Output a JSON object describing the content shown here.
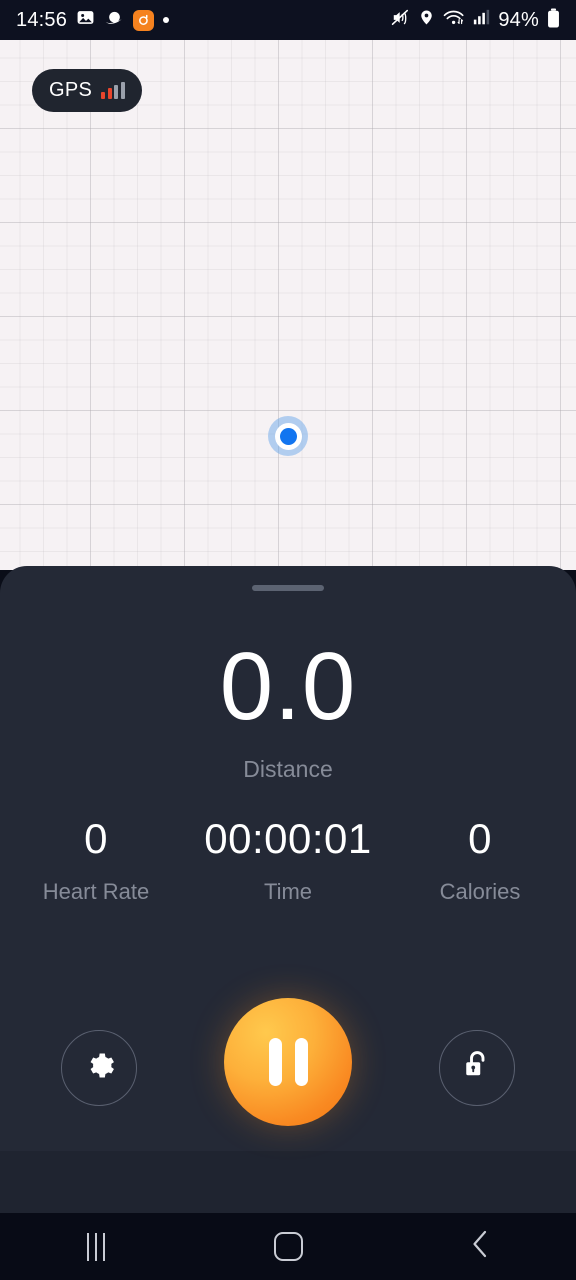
{
  "status_bar": {
    "time": "14:56",
    "battery_percent": "94%",
    "left_icons": [
      "photo-gallery-icon",
      "planet-icon",
      "orange-app-icon",
      "notification-dot-icon"
    ],
    "right_icons": [
      "mute-icon",
      "location-pin-icon",
      "wifi-icon",
      "cellular-signal-icon",
      "battery-icon"
    ]
  },
  "map": {
    "gps_badge_label": "GPS",
    "gps_signal_bars": 4,
    "gps_active_bars": 2,
    "user_marker": "current-location-marker"
  },
  "panel": {
    "distance": {
      "value": "0.0",
      "label": "Distance"
    },
    "stats": [
      {
        "value": "0",
        "label": "Heart Rate"
      },
      {
        "value": "00:00:01",
        "label": "Time"
      },
      {
        "value": "0",
        "label": "Calories"
      }
    ],
    "controls": {
      "settings_icon": "gear-icon",
      "primary_action_icon": "pause-icon",
      "lock_icon": "unlocked-padlock-icon"
    }
  },
  "nav_bar": {
    "recents_label": "recents-icon",
    "home_label": "home-icon",
    "back_label": "back-icon"
  },
  "colors": {
    "map_bg": "#f6f2f4",
    "panel_bg": "#242936",
    "accent_orange": "#f98a22",
    "marker_blue": "#1275f0",
    "gps_red": "#e8452c",
    "muted_text": "#868b98"
  }
}
